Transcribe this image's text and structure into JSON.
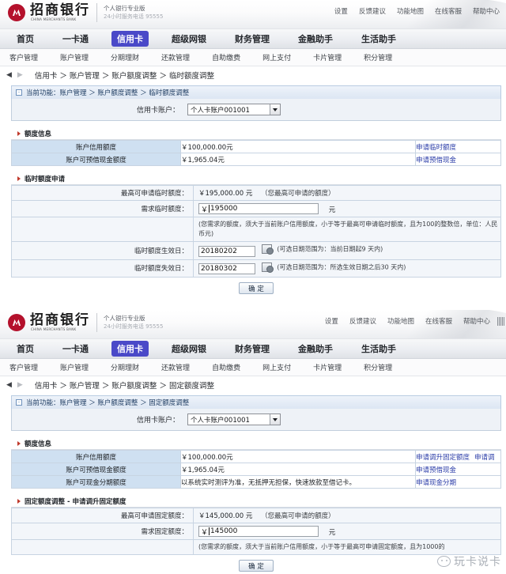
{
  "brand": {
    "name_cn": "招商银行",
    "name_en": "CHINA MERCHANTS BANK",
    "tagline": "个人银行专业版",
    "hotline": "24小时服务电话 95555"
  },
  "header_links": [
    "设置",
    "反馈建议",
    "功能地图",
    "在线客服",
    "帮助中心"
  ],
  "main_nav": [
    {
      "label": "首页",
      "active": false
    },
    {
      "label": "一卡通",
      "active": false
    },
    {
      "label": "信用卡",
      "active": true
    },
    {
      "label": "超级网银",
      "active": false
    },
    {
      "label": "财务管理",
      "active": false
    },
    {
      "label": "金融助手",
      "active": false
    },
    {
      "label": "生活助手",
      "active": false
    }
  ],
  "sub_nav": [
    "客户管理",
    "账户管理",
    "分期理财",
    "还款管理",
    "自助缴费",
    "网上支付",
    "卡片管理",
    "积分管理"
  ],
  "panel1": {
    "breadcrumb": "信用卡 ＞ 账户管理 ＞ 账户额度调整 ＞ 临时额度调整",
    "current_function": "当前功能：账户管理 ＞ 账户额度调整 ＞ 临时额度调整",
    "account_label": "信用卡账户：",
    "account_value": "个人卡账户001001",
    "section_limit_info": "额度信息",
    "limit_rows": [
      {
        "label": "账户信用额度",
        "value": "￥100,000.00元",
        "links": [
          "申请临时额度"
        ]
      },
      {
        "label": "账户可预借现金额度",
        "value": "￥1,965.04元",
        "links": [
          "申请预借现金"
        ]
      }
    ],
    "section_apply": "临时额度申请",
    "max_label": "最高可申请临时额度：",
    "max_value": "￥195,000.00 元",
    "max_hint": "（您最高可申请的额度）",
    "need_label": "需求临时额度：",
    "need_currency": "￥",
    "need_value": "195000",
    "need_unit": "元",
    "need_note": "(您需求的额度，须大于当前账户信用额度，小于等于最高可申请临时额度，且为100的整数倍，单位：人民币元)",
    "start_label": "临时额度生效日：",
    "start_value": "20180202",
    "start_note": "(可选日期范围为：当前日期起9 天内)",
    "end_label": "临时额度失效日：",
    "end_value": "20180302",
    "end_note": "(可选日期范围为：所选生效日期之后30 天内)",
    "submit": "确 定"
  },
  "panel2": {
    "breadcrumb": "信用卡 ＞ 账户管理 ＞ 账户额度调整 ＞ 固定额度调整",
    "current_function": "当前功能：账户管理 ＞ 账户额度调整 ＞ 固定额度调整",
    "account_label": "信用卡账户：",
    "account_value": "个人卡账户001001",
    "section_limit_info": "额度信息",
    "limit_rows": [
      {
        "label": "账户信用额度",
        "value": "￥100,000.00元",
        "links": [
          "申请调升固定额度",
          "申请调"
        ]
      },
      {
        "label": "账户可预借现金额度",
        "value": "￥1,965.04元",
        "links": [
          "申请预借现金"
        ]
      },
      {
        "label": "账户可现金分期额度",
        "value": "以系统实时测评为准，无抵押无担保，快速放款至借记卡。",
        "links": [
          "申请现金分期"
        ]
      }
    ],
    "section_apply": "固定额度调整 - 申请调升固定额度",
    "max_label": "最高可申请固定额度：",
    "max_value": "￥145,000.00 元",
    "max_hint": "（您最高可申请的额度）",
    "need_label": "需求固定额度：",
    "need_currency": "￥",
    "need_value": "145000",
    "need_unit": "元",
    "need_note": "(您需求的额度，须大于当前账户信用额度，小于等于最高可申请固定额度，且为1000的",
    "submit": "确 定"
  },
  "watermark": "玩卡说卡",
  "colors": {
    "brand_red": "#b4112c",
    "nav_active": "#4a49c8",
    "link_blue": "#2b3da8",
    "table_header_blue": "#cfe0f1"
  }
}
